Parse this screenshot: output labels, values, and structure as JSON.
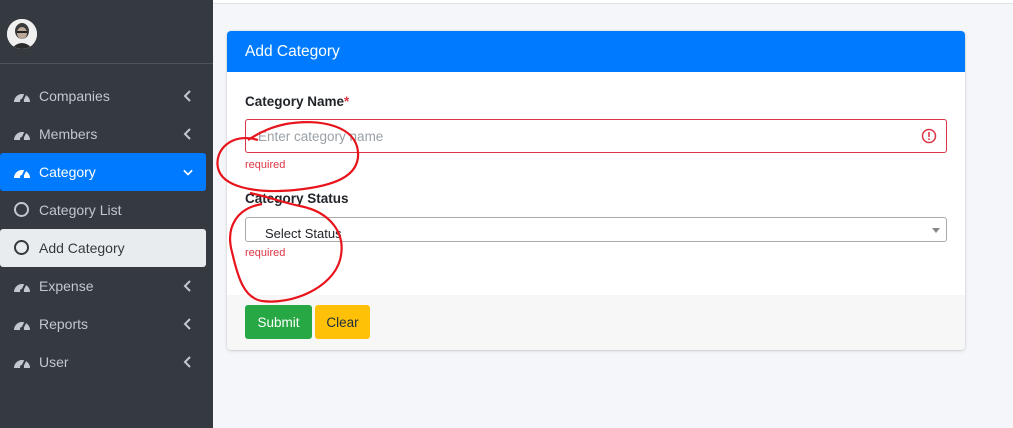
{
  "sidebar": {
    "items": [
      {
        "label": "Companies",
        "icon": "tachometer-icon"
      },
      {
        "label": "Members",
        "icon": "tachometer-icon"
      },
      {
        "label": "Category",
        "icon": "tachometer-icon"
      },
      {
        "label": "Category List",
        "icon": "circle-icon"
      },
      {
        "label": "Add Category",
        "icon": "circle-icon"
      },
      {
        "label": "Expense",
        "icon": "tachometer-icon"
      },
      {
        "label": "Reports",
        "icon": "tachometer-icon"
      },
      {
        "label": "User",
        "icon": "tachometer-icon"
      }
    ]
  },
  "card": {
    "title": "Add Category",
    "name_label": "Category Name",
    "required_mark": "*",
    "name_placeholder": "Enter category name",
    "name_error": "required",
    "status_label": "Category Status",
    "status_selected": "Select Status",
    "status_error": "required",
    "submit_label": "Submit",
    "clear_label": "Clear"
  },
  "colors": {
    "sidebar_bg": "#343a40",
    "primary": "#007bff",
    "danger": "#dc3545",
    "success": "#28a745",
    "warning": "#ffc107"
  }
}
